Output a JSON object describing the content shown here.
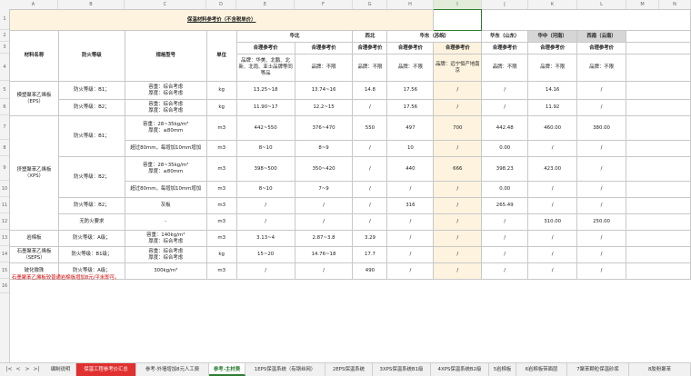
{
  "columns": [
    "A",
    "B",
    "C",
    "D",
    "E",
    "F",
    "G",
    "H",
    "I",
    "J",
    "K",
    "L",
    "M",
    "N"
  ],
  "rows": [
    "1",
    "2",
    "3",
    "4",
    "5",
    "6",
    "7",
    "8",
    "9",
    "10",
    "11",
    "12",
    "13",
    "14",
    "15",
    "16"
  ],
  "title": "保温材料参考价（不含税单价）",
  "header": {
    "material": "材料名称",
    "fire": "防火等级",
    "spec": "规格型号",
    "unit": "单位",
    "regions": [
      "华北",
      "西北",
      "华东（苏皖）",
      "华东（山东）",
      "华中（河南）",
      "西南（云南）"
    ],
    "price_label": "合理参考价",
    "brands": [
      "品牌：华美、北鹏、北新、北雨、亚士品牌等同等品",
      "品牌：不限",
      "品牌：不限",
      "品牌：不限",
      "品牌：远宁恒产地南京",
      "品牌：不限",
      "品牌：不限",
      "品牌：不限"
    ]
  },
  "body": {
    "eps_name": "模塑聚苯乙烯板\n（EPS）",
    "eps_b1": "防火等级：B1；",
    "eps_b2": "防火等级：B2；",
    "eps_spec": "容重：综合考虑\n厚度：综合考虑",
    "unit_kg": "kg",
    "unit_m3": "m3",
    "eps_r5": [
      "13.25~18",
      "13.74~16",
      "14.8",
      "17.56",
      "/",
      "/",
      "14.16",
      "/"
    ],
    "eps_r6": [
      "11.90~17",
      "12.2~15",
      "/",
      "17.56",
      "/",
      "/",
      "11.92",
      "/"
    ],
    "xps_name": "挤塑聚苯乙烯板\n（XPS）",
    "xps_b1": "防火等级：B1；",
    "xps_b2": "防火等级：B2；",
    "xps_b2b": "防火等级：B2；",
    "xps_spec": "容重：28~35kg/m³\n厚度：≤80mm",
    "xps_extra": "超过80mm，每增加10mm增加",
    "xps_board": "灰板",
    "r7": [
      "442~550",
      "376~470",
      "550",
      "497",
      "700",
      "442.48",
      "460.00",
      "380.00"
    ],
    "r8": [
      "8~10",
      "8~9",
      "/",
      "10",
      "/",
      "0.00",
      "/",
      "/"
    ],
    "r9": [
      "398~500",
      "350~420",
      "/",
      "440",
      "666",
      "398.23",
      "423.00",
      "/"
    ],
    "r10": [
      "8~10",
      "7~9",
      "/",
      "/",
      "/",
      "0.00",
      "/",
      "/"
    ],
    "r11": [
      "/",
      "/",
      "/",
      "316",
      "/",
      "265.49",
      "/",
      "/"
    ],
    "r12_fire": "无防火要求",
    "r12_spec": "-",
    "r12": [
      "/",
      "/",
      "/",
      "/",
      "/",
      "/",
      "310.00",
      "250.00"
    ],
    "rock_name": "岩棉板",
    "rock_fire": "防火等级：A级；",
    "rock_spec": "容重：140kg/m³\n厚度：综合考虑",
    "r13": [
      "3.13~4",
      "2.87~3.8",
      "3.29",
      "/",
      "/",
      "/",
      "/",
      "/"
    ],
    "seps_name": "石墨聚苯乙烯板\n（SEPS）",
    "seps_fire": "防火等级：B1级；",
    "seps_spec": "容重：综合考虑\n厚度：综合考虑",
    "r14": [
      "15~20",
      "14.76~18",
      "17.7",
      "/",
      "/",
      "/",
      "/",
      "/"
    ],
    "glass_name": "玻化微珠",
    "glass_fire": "防火等级：A级；",
    "glass_spec": "300kg/m³",
    "r15": [
      "/",
      "/",
      "490",
      "/",
      "/",
      "/",
      "/",
      "/"
    ]
  },
  "note": "石墨聚苯乙烯板较普通岩棉板增加8元/平米即可。",
  "tabs": [
    "编制说明",
    "保温工程参考价汇总",
    "参考-外墙增加8元人工费",
    "参考-主材费",
    "1EPS保温系统（有钢丝网）",
    "2EPS保温系统",
    "3XPS保温系统B1级",
    "4XPS保温系统B2级",
    "5岩棉板",
    "6岩棉板带面层",
    "7聚苯颗粒保温砂浆",
    "8胶粉聚苯"
  ]
}
